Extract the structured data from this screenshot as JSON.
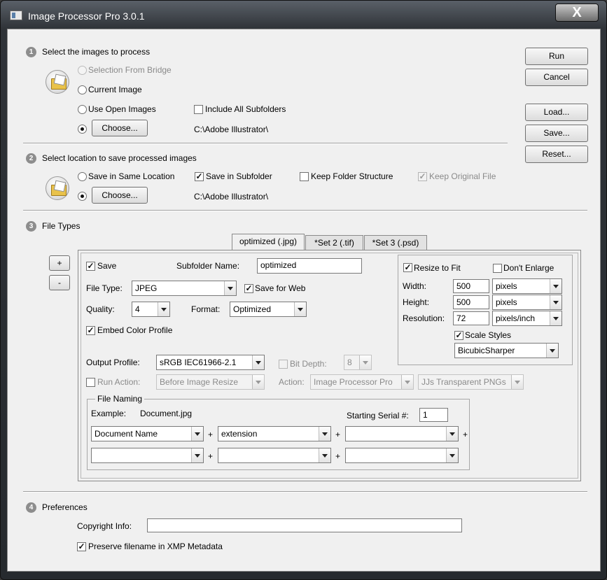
{
  "window": {
    "title": "Image Processor Pro 3.0.1",
    "close_label": "X"
  },
  "side_buttons": {
    "run": "Run",
    "cancel": "Cancel",
    "load": "Load...",
    "save": "Save...",
    "reset": "Reset..."
  },
  "section1": {
    "number": "1",
    "title": "Select the images to process",
    "from_bridge": "Selection From Bridge",
    "current_image": "Current Image",
    "open_images": "Use Open Images",
    "include_subfolders": "Include All Subfolders",
    "choose": "Choose...",
    "path": "C:\\Adobe Illustrator\\"
  },
  "section2": {
    "number": "2",
    "title": "Select location to save processed images",
    "same_location": "Save in Same Location",
    "save_subfolder": "Save in Subfolder",
    "keep_structure": "Keep Folder Structure",
    "keep_original": "Keep Original File",
    "choose": "Choose...",
    "path": "C:\\Adobe Illustrator\\"
  },
  "section3": {
    "number": "3",
    "title": "File Types",
    "plus": "+",
    "minus": "-",
    "tabs": [
      "optimized (.jpg)",
      "*Set 2 (.tif)",
      "*Set 3 (.psd)"
    ],
    "save": "Save",
    "subfolder_label": "Subfolder Name:",
    "subfolder_value": "optimized",
    "file_type_label": "File Type:",
    "file_type_value": "JPEG",
    "save_for_web": "Save for Web",
    "quality_label": "Quality:",
    "quality_value": "4",
    "format_label": "Format:",
    "format_value": "Optimized",
    "embed_profile": "Embed Color Profile",
    "output_profile_label": "Output Profile:",
    "output_profile_value": "sRGB IEC61966-2.1",
    "bit_depth_label": "Bit Depth:",
    "bit_depth_value": "8",
    "run_action": "Run Action:",
    "run_action_value": "Before Image Resize",
    "action_label": "Action:",
    "action_set_value": "Image Processor Pro",
    "action_name_value": "JJs Transparent PNGs",
    "resize": {
      "resize_to_fit": "Resize to Fit",
      "dont_enlarge": "Don't Enlarge",
      "width_label": "Width:",
      "width_value": "500",
      "width_unit": "pixels",
      "height_label": "Height:",
      "height_value": "500",
      "height_unit": "pixels",
      "resolution_label": "Resolution:",
      "resolution_value": "72",
      "resolution_unit": "pixels/inch",
      "scale_styles": "Scale Styles",
      "resample_value": "BicubicSharper"
    },
    "naming": {
      "legend": "File Naming",
      "example_label": "Example:",
      "example_value": "Document.jpg",
      "serial_label": "Starting Serial #:",
      "serial_value": "1",
      "fields": [
        "Document Name",
        "extension",
        "",
        "",
        "",
        ""
      ],
      "plus": "+"
    }
  },
  "section4": {
    "number": "4",
    "title": "Preferences",
    "copyright_label": "Copyright Info:",
    "copyright_value": "",
    "preserve_xmp": "Preserve filename in XMP Metadata"
  },
  "checkmark": "✓"
}
